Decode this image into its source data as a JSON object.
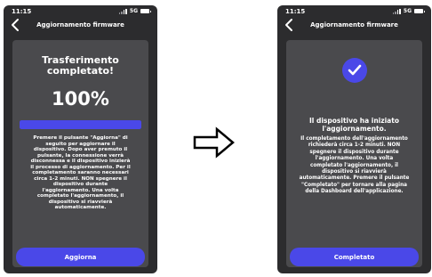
{
  "left_screen": {
    "status": {
      "time": "11:15",
      "network": "5G"
    },
    "nav": {
      "title": "Aggiornamento firmware"
    },
    "transfer": {
      "title_line1": "Trasferimento",
      "title_line2": "completato!",
      "percent_label": "100%",
      "progress_fraction": 1.0,
      "body_lines": [
        "Premere il pulsante \"Aggiorna\" di",
        "seguito per aggiornare il",
        "dispositivo. Dopo aver premuto il",
        "pulsante, la connessione verrà",
        "disconnessa e il dispositivo inizierà",
        "il processo di aggiornamento. Per il",
        "completamento saranno necessari",
        "circa 1-2 minuti. NON spegnere il",
        "dispositivo durante",
        "l'aggiornamento. Una volta",
        "completato l'aggiornamento, il",
        "dispositivo si riavvierà",
        "automaticamente."
      ]
    },
    "button_label": "Aggiorna"
  },
  "right_screen": {
    "status": {
      "time": "11:15",
      "network": "5G"
    },
    "nav": {
      "title": "Aggiornamento firmware"
    },
    "started": {
      "title_line1": "Il dispositivo ha iniziato",
      "title_line2": "l'aggiornamento.",
      "body_lines": [
        "Il completamento dell'aggiornamento",
        "richiederà circa 1-2 minuti. NON",
        "spegnere il dispositivo durante",
        "l'aggiornamento. Una volta",
        "completato l'aggiornamento, il",
        "dispositivo si riavvierà",
        "automaticamente. Premere il pulsante",
        "\"Completato\" per tornare alla pagina",
        "della Dashboard dell'applicazione."
      ]
    },
    "button_label": "Completato"
  },
  "colors": {
    "accent": "#4a48e8",
    "phone_bg": "#2c2c2e",
    "card_bg": "#4a4a4d"
  },
  "icons": {
    "back": "chevron-left-icon",
    "check": "check-icon",
    "arrow": "right-arrow-icon"
  }
}
